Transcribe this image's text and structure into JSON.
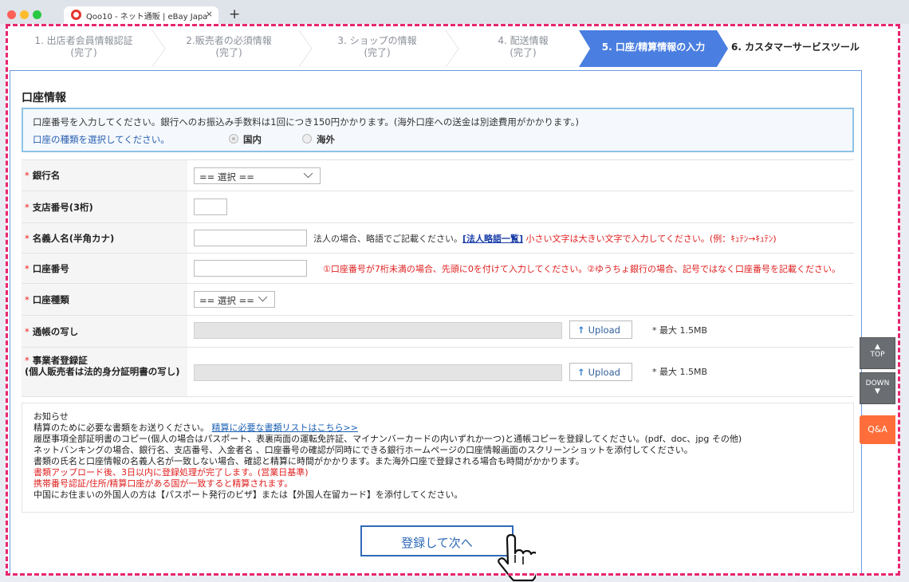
{
  "browser": {
    "tab_title": "Qoo10 - ネット通販 | eBay Japa",
    "close": "×",
    "new_tab": "+"
  },
  "steps": [
    {
      "label": "1. 出店者会員情報認証",
      "status": "(完了)"
    },
    {
      "label": "2.販売者の必須情報",
      "status": "(完了)"
    },
    {
      "label": "3. ショップの情報",
      "status": "(完了)"
    },
    {
      "label": "4. 配送情報",
      "status": "(完了)"
    },
    {
      "label": "5. 口座/精算情報の入力",
      "status": ""
    },
    {
      "label": "6. カスタマーサービスツール",
      "status": ""
    }
  ],
  "section": {
    "title": "口座情報",
    "info_text": "口座番号を入力してください。銀行へのお振込み手数料は1回につき150円かかります。(海外口座への送金は別途費用がかかります。)",
    "account_type_prompt": "口座の種類を選択してください。",
    "radio_domestic": "国内",
    "radio_overseas": "海外"
  },
  "form": {
    "required_mark": "*",
    "bank_name_label": "銀行名",
    "bank_select": "== 選択 ==",
    "branch_label": "支店番号(3桁)",
    "holder_label": "名義人名(半角カナ)",
    "holder_note_1": "法人の場合、略語でご記載ください。",
    "holder_note_link": "[法人略語一覧]",
    "holder_note_2": " 小さい文字は大きい文字で入力してください。(例：ｷｭﾃﾝ→ｷｭﾃﾝ)",
    "account_no_label": "口座番号",
    "account_no_note": "①口座番号が7桁未満の場合、先頭に0を付けて入力してください。②ゆうちょ銀行の場合、記号ではなく口座番号を記載ください。",
    "account_type_label": "口座種類",
    "account_type_select": "== 選択 ==",
    "passbook_label": "通帳の写し",
    "upload_label": "Upload",
    "max_size": "* 最大 1.5MB",
    "business_cert_label": "事業者登録証",
    "business_cert_sub": "(個人販売者は法的身分証明書の写し)"
  },
  "notice": {
    "title": "お知らせ",
    "line1_text": "精算のために必要な書類をお送りください。",
    "line1_link": "精算に必要な書類リストはこちら>>",
    "line2": "履歴事項全部証明書のコピー(個人の場合はパスポート、表裏両面の運転免許証、マイナンバーカードの内いずれか一つ)と通帳コピーを登録してください。(pdf、doc、jpg その他)",
    "line3": "ネットバンキングの場合、銀行名、支店番号、入金者名 、口座番号の確認が同時にできる銀行ホームページの口座情報画面のスクリーンショットを添付してください。",
    "line4": "書類の氏名と口座情報の名義人名が一致しない場合、確認と精算に時間がかかります。また海外口座で登録される場合も時間がかかります。",
    "line5": "書類アップロード後、3日以内に登録処理が完了します。(営業日基準)",
    "line6": "携帯番号認証/住所/精算口座がある国が一致すると精算されます。",
    "line7": "中国にお住まいの外国人の方は【パスポート発行のビザ】または【外国人在留カード】を添付してください。"
  },
  "submit_label": "登録して次へ",
  "side": {
    "top": "TOP",
    "down": "DOWN",
    "qa": "Q&A"
  },
  "colors": {
    "accent": "#4a7ee0",
    "dash": "#e8266f",
    "qa": "#ff6e3a",
    "required": "#e22222"
  }
}
